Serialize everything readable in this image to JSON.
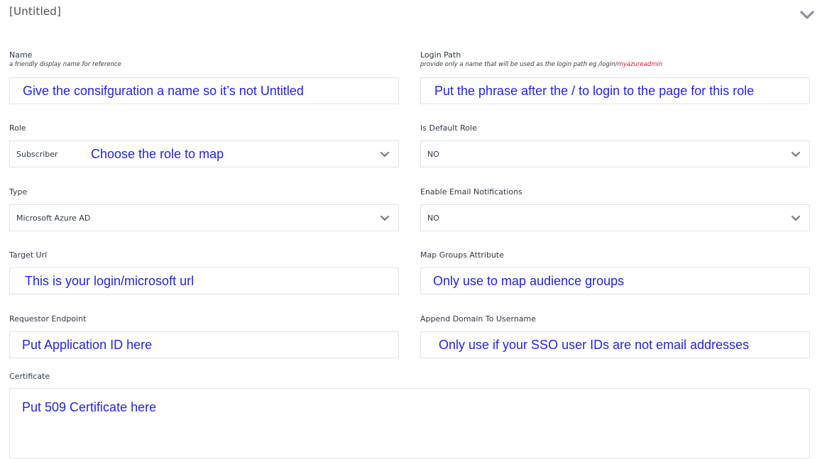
{
  "header": {
    "title": "[Untitled]",
    "collapse_icon": "chevron-down-icon"
  },
  "fields": {
    "name": {
      "label": "Name",
      "hint": "a friendly display name for reference",
      "note": "Give the consifguration a name so it’s not Untitled"
    },
    "login_path": {
      "label": "Login Path",
      "hint": "provide only a name that will be used as the login path eg /login/",
      "hint_accent": "myazureadmin",
      "note": "Put the phrase after the / to login to the page for this role"
    },
    "role": {
      "label": "Role",
      "value": "Subscriber",
      "note": "Choose the role to map"
    },
    "is_default_role": {
      "label": "Is Default Role",
      "value": "NO"
    },
    "type": {
      "label": "Type",
      "value": "Microsoft Azure AD"
    },
    "enable_email_notifications": {
      "label": "Enable Email Notifications",
      "value": "NO"
    },
    "target_url": {
      "label": "Target Url",
      "note": "This is your login/microsoft url"
    },
    "map_groups_attribute": {
      "label": "Map Groups Attribute",
      "note": "Only use to map audience groups"
    },
    "requestor_endpoint": {
      "label": "Requestor Endpoint",
      "note": "Put Application ID here"
    },
    "append_domain": {
      "label": "Append Domain To Username",
      "note": "Only use if your SSO user IDs are not email addresses"
    },
    "certificate": {
      "label": "Certificate",
      "note": "Put 509 Certificate here"
    }
  },
  "colors": {
    "annotation_blue": "#2222ee",
    "hint_accent_red": "#e0102e",
    "label_text": "#2b3a4a",
    "border": "#dfe3e8"
  }
}
